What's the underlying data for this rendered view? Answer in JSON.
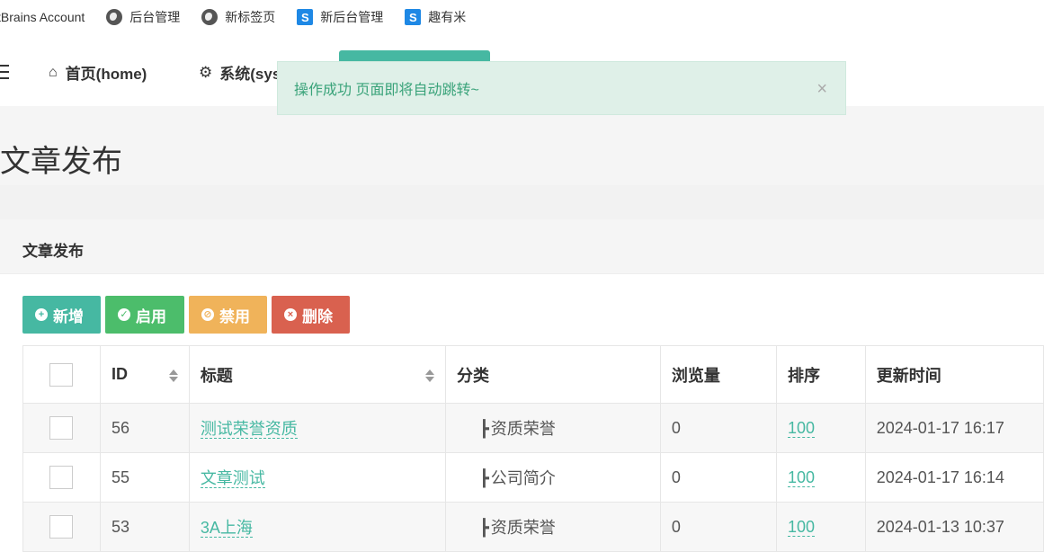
{
  "bookmarks": [
    {
      "label": "tBrains Account",
      "icon": "none"
    },
    {
      "label": "后台管理",
      "icon": "globe-icon"
    },
    {
      "label": "新标签页",
      "icon": "globe-icon"
    },
    {
      "label": "新后台管理",
      "icon": "s-icon"
    },
    {
      "label": "趣有米",
      "icon": "s-icon"
    }
  ],
  "bookmark_s_glyph": "S",
  "nav": {
    "home_label": "首页(home)",
    "system_label": "系统(sys"
  },
  "alert": {
    "message": "操作成功 页面即将自动跳转~",
    "close_glyph": "×"
  },
  "page": {
    "title": "文章发布"
  },
  "panel": {
    "title": "文章发布"
  },
  "toolbar": {
    "add": "新增",
    "enable": "启用",
    "disable": "禁用",
    "delete": "删除"
  },
  "table": {
    "headers": {
      "id": "ID",
      "title": "标题",
      "category": "分类",
      "views": "浏览量",
      "sort": "排序",
      "updated": "更新时间"
    },
    "rows": [
      {
        "id": "56",
        "title": "测试荣誉资质",
        "category": "资质荣誉",
        "views": "0",
        "sort": "100",
        "updated": "2024-01-17 16:17"
      },
      {
        "id": "55",
        "title": "文章测试",
        "category": "公司简介",
        "views": "0",
        "sort": "100",
        "updated": "2024-01-17 16:14"
      },
      {
        "id": "53",
        "title": "3A上海",
        "category": "资质荣誉",
        "views": "0",
        "sort": "100",
        "updated": "2024-01-13 10:37"
      }
    ],
    "category_prefix": "┣"
  },
  "colors": {
    "accent": "#46b8a2",
    "success": "#4cbd6b",
    "warning": "#f0b35a",
    "danger": "#d9614f"
  }
}
